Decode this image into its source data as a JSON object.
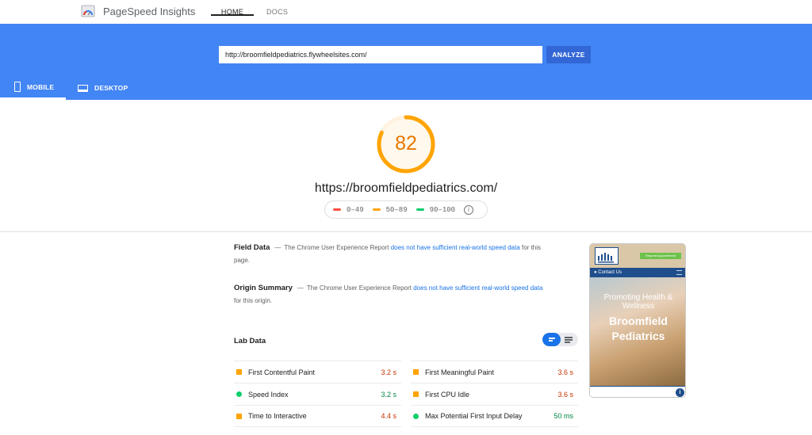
{
  "app": {
    "title": "PageSpeed Insights"
  },
  "nav": {
    "home": "HOME",
    "docs": "DOCS"
  },
  "search": {
    "value": "http://broomfieldpediatrics.flywheelsites.com/",
    "analyze_label": "ANALYZE"
  },
  "device_tabs": {
    "mobile": "MOBILE",
    "desktop": "DESKTOP",
    "selected": "mobile"
  },
  "score": {
    "value": "82",
    "fraction": 0.82,
    "color": "#ffa400"
  },
  "site_url": "https://broomfieldpediatrics.com/",
  "legend": [
    {
      "label": "0–49",
      "color": "#ff4e42"
    },
    {
      "label": "50–89",
      "color": "#ffa400"
    },
    {
      "label": "90–100",
      "color": "#0cce6b"
    }
  ],
  "field_data": {
    "title": "Field Data",
    "text_before": "The Chrome User Experience Report",
    "link": "does not have sufficient real-world speed data",
    "text_after": "for this page."
  },
  "origin_summary": {
    "title": "Origin Summary",
    "text_before": "The Chrome User Experience Report",
    "link": "does not have sufficient real-world speed data",
    "text_after": "for this origin."
  },
  "lab_data": {
    "title": "Lab Data",
    "left": [
      {
        "label": "First Contentful Paint",
        "value": "3.2 s",
        "status": "average"
      },
      {
        "label": "Speed Index",
        "value": "3.2 s",
        "status": "pass"
      },
      {
        "label": "Time to Interactive",
        "value": "4.4 s",
        "status": "average"
      }
    ],
    "right": [
      {
        "label": "First Meaningful Paint",
        "value": "3.6 s",
        "status": "average"
      },
      {
        "label": "First CPU Idle",
        "value": "3.6 s",
        "status": "average"
      },
      {
        "label": "Max Potential First Input Delay",
        "value": "50 ms",
        "status": "pass"
      }
    ]
  },
  "status_colors": {
    "average": "#ffa400",
    "pass": "#0cce6b",
    "average_text": "#c33300",
    "pass_text": "#018642"
  },
  "thumbnail": {
    "button": "Request Appointment",
    "nav": "Contact Us",
    "tagline": "Promoting Health & Wellness",
    "name": "Broomfield Pediatrics",
    "badge": "i"
  }
}
